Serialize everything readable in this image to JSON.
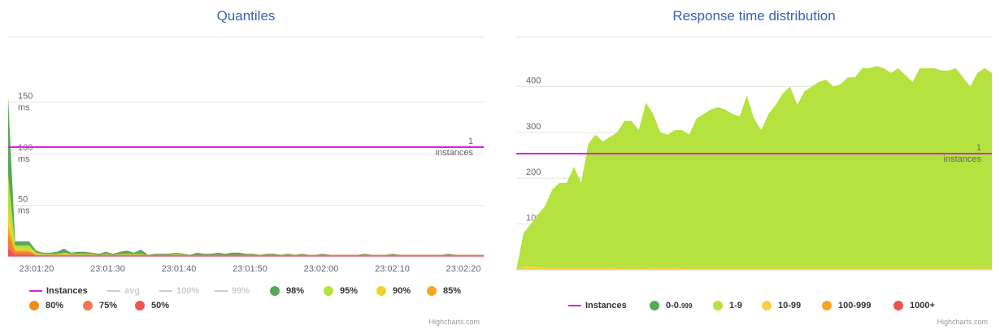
{
  "chart_data": [
    {
      "type": "area",
      "title": "Quantiles",
      "ylim": [
        0,
        160
      ],
      "y_ticks": [
        {
          "value": 150,
          "line1": "150",
          "line2": "ms"
        },
        {
          "value": 100,
          "line1": "100",
          "line2": "ms"
        },
        {
          "value": 50,
          "line1": "50",
          "line2": "ms"
        }
      ],
      "x_ticks": [
        "23:01:20",
        "23:01:30",
        "23:01:40",
        "23:01:50",
        "23:02:00",
        "23:02:10",
        "23:02:20"
      ],
      "instances": {
        "label": "1",
        "unit": "instances",
        "value": 1
      },
      "series_order_drawn": [
        "98%",
        "95%",
        "90%",
        "85%",
        "80%",
        "75%",
        "50%"
      ],
      "series": [
        {
          "name": "98%",
          "color": "#5aa75a",
          "values": [
            155,
            15,
            15,
            15,
            6,
            4,
            4,
            5,
            8,
            4,
            5,
            5,
            4,
            3,
            5,
            3,
            5,
            6,
            4,
            7,
            2,
            3,
            3,
            3,
            4,
            3,
            2,
            4,
            3,
            3,
            4,
            3,
            4,
            4,
            3,
            3,
            2,
            3,
            3,
            2,
            3,
            2,
            3,
            2,
            2,
            3,
            2,
            2,
            2,
            2,
            2,
            3,
            2,
            2,
            2,
            3,
            2,
            2,
            2,
            2,
            2,
            2,
            2,
            3,
            2,
            2,
            2,
            2,
            2
          ]
        },
        {
          "name": "95%",
          "color": "#b6e23f",
          "values": [
            80,
            11,
            11,
            11,
            4,
            3,
            3,
            3,
            4,
            3,
            3,
            3,
            3,
            2,
            3,
            2,
            3,
            3,
            3,
            3,
            2,
            2,
            2,
            2,
            3,
            2,
            2,
            2,
            2,
            2,
            2,
            2,
            2,
            2,
            2,
            2,
            2,
            2,
            2,
            2,
            2,
            2,
            2,
            2,
            2,
            2,
            2,
            2,
            2,
            2,
            2,
            2,
            2,
            2,
            2,
            2,
            2,
            2,
            2,
            2,
            2,
            2,
            2,
            2,
            2,
            2,
            2,
            2,
            2
          ]
        },
        {
          "name": "90%",
          "color": "#f2d22e",
          "values": [
            45,
            8,
            8,
            8,
            3,
            2,
            2,
            2,
            3,
            2,
            2,
            2,
            2,
            2,
            2,
            2,
            2,
            2,
            2,
            2,
            2,
            2,
            2,
            2,
            2,
            2,
            2,
            2,
            2,
            2,
            2,
            2,
            2,
            2,
            2,
            2,
            2,
            2,
            2,
            2,
            2,
            2,
            2,
            2,
            2,
            2,
            2,
            2,
            2,
            2,
            2,
            2,
            2,
            2,
            2,
            2,
            2,
            2,
            2,
            2,
            2,
            2,
            2,
            2,
            2,
            2,
            2,
            2,
            2
          ]
        },
        {
          "name": "85%",
          "color": "#f5a623",
          "values": [
            30,
            6,
            6,
            6,
            2,
            2,
            2,
            2,
            2,
            2,
            2,
            2,
            2,
            2,
            2,
            2,
            2,
            2,
            2,
            2,
            2,
            2,
            2,
            2,
            2,
            2,
            2,
            2,
            2,
            2,
            2,
            2,
            2,
            2,
            2,
            2,
            2,
            2,
            2,
            2,
            2,
            2,
            2,
            2,
            2,
            2,
            2,
            2,
            2,
            2,
            2,
            2,
            2,
            2,
            2,
            2,
            2,
            2,
            2,
            2,
            2,
            2,
            2,
            2,
            2,
            2,
            2,
            2,
            2
          ]
        },
        {
          "name": "80%",
          "color": "#f08c1e",
          "values": [
            22,
            5,
            5,
            5,
            2,
            2,
            2,
            2,
            2,
            2,
            2,
            2,
            2,
            2,
            2,
            2,
            2,
            2,
            2,
            2,
            2,
            2,
            2,
            2,
            2,
            2,
            2,
            2,
            2,
            2,
            2,
            2,
            2,
            2,
            2,
            2,
            2,
            2,
            2,
            2,
            2,
            2,
            2,
            2,
            2,
            2,
            2,
            2,
            2,
            2,
            2,
            2,
            2,
            2,
            2,
            2,
            2,
            2,
            2,
            2,
            2,
            2,
            2,
            2,
            2,
            2,
            2,
            2,
            2
          ]
        },
        {
          "name": "75%",
          "color": "#f2784b",
          "values": [
            16,
            4,
            4,
            4,
            2,
            2,
            2,
            2,
            2,
            2,
            2,
            2,
            2,
            2,
            2,
            2,
            2,
            2,
            2,
            2,
            2,
            2,
            2,
            2,
            2,
            2,
            2,
            2,
            2,
            2,
            2,
            2,
            2,
            2,
            2,
            2,
            2,
            2,
            2,
            2,
            2,
            2,
            2,
            2,
            2,
            2,
            2,
            2,
            2,
            2,
            2,
            2,
            2,
            2,
            2,
            2,
            2,
            2,
            2,
            2,
            2,
            2,
            2,
            2,
            2,
            2,
            2,
            2,
            2
          ]
        },
        {
          "name": "50%",
          "color": "#ef5350",
          "values": [
            8,
            2,
            2,
            2,
            1,
            1,
            1,
            1,
            1,
            1,
            1,
            1,
            1,
            1,
            1,
            1,
            1,
            1,
            1,
            1,
            1,
            1,
            1,
            1,
            1,
            1,
            1,
            1,
            1,
            1,
            1,
            1,
            1,
            1,
            1,
            1,
            1,
            1,
            1,
            1,
            1,
            1,
            1,
            1,
            1,
            1,
            1,
            1,
            1,
            1,
            1,
            1,
            1,
            1,
            1,
            1,
            1,
            1,
            1,
            1,
            1,
            1,
            1,
            1,
            1,
            1,
            1,
            1,
            1
          ]
        }
      ],
      "legend": [
        {
          "label": "Instances",
          "symbol": "line",
          "color": "#e619e6",
          "visible": true
        },
        {
          "label": "avg",
          "symbol": "line",
          "color": "#cccccc",
          "visible": false
        },
        {
          "label": "100%",
          "symbol": "line",
          "color": "#cccccc",
          "visible": false
        },
        {
          "label": "99%",
          "symbol": "line",
          "color": "#cccccc",
          "visible": false
        },
        {
          "label": "98%",
          "symbol": "dot",
          "color": "#5aa75a",
          "visible": true
        },
        {
          "label": "95%",
          "symbol": "dot",
          "color": "#b6e23f",
          "visible": true
        },
        {
          "label": "90%",
          "symbol": "dot",
          "color": "#f2d22e",
          "visible": true
        },
        {
          "label": "85%",
          "symbol": "dot",
          "color": "#f5a623",
          "visible": true
        },
        {
          "label": "80%",
          "symbol": "dot",
          "color": "#f08c1e",
          "visible": true
        },
        {
          "label": "75%",
          "symbol": "dot",
          "color": "#f2784b",
          "visible": true
        },
        {
          "label": "50%",
          "symbol": "dot",
          "color": "#ef5350",
          "visible": true
        }
      ],
      "credits": "Highcharts.com"
    },
    {
      "type": "area",
      "title": "Response time distribution",
      "ylim": [
        0,
        470
      ],
      "y_ticks": [
        {
          "value": 400,
          "line1": "400"
        },
        {
          "value": 300,
          "line1": "300"
        },
        {
          "value": 200,
          "line1": "200"
        },
        {
          "value": 100,
          "line1": "100"
        }
      ],
      "x_ticks": [
        "23:01:20",
        "23:01:30",
        "23:01:40",
        "23:01:50",
        "23:02:00",
        "23:02:10",
        "23:02:20"
      ],
      "instances": {
        "label": "1",
        "unit": "instances",
        "value": 1
      },
      "series": [
        {
          "name": "1-9",
          "color": "#b6e23f",
          "values": [
            0,
            80,
            100,
            120,
            140,
            175,
            190,
            190,
            225,
            190,
            275,
            295,
            280,
            290,
            300,
            325,
            325,
            305,
            365,
            340,
            300,
            295,
            305,
            305,
            295,
            330,
            340,
            350,
            355,
            350,
            340,
            335,
            380,
            330,
            305,
            340,
            360,
            385,
            400,
            360,
            390,
            400,
            410,
            415,
            400,
            405,
            420,
            420,
            440,
            440,
            445,
            440,
            430,
            440,
            425,
            410,
            440,
            440,
            440,
            435,
            435,
            440,
            420,
            400,
            430,
            440,
            430
          ]
        },
        {
          "name": "10-99",
          "color": "#f7d046",
          "values": [
            0,
            8,
            8,
            6,
            6,
            5,
            5,
            5,
            4,
            4,
            4,
            4,
            4,
            4,
            4,
            3,
            3,
            3,
            4,
            4,
            6,
            4,
            4,
            4,
            3,
            3,
            3,
            3,
            3,
            3,
            3,
            3,
            3,
            3,
            3,
            3,
            3,
            3,
            3,
            3,
            3,
            3,
            3,
            3,
            3,
            3,
            3,
            3,
            3,
            3,
            3,
            3,
            3,
            3,
            3,
            3,
            3,
            3,
            3,
            3,
            3,
            3,
            3,
            3,
            3,
            3,
            3
          ]
        }
      ],
      "legend": [
        {
          "label": "Instances",
          "symbol": "line",
          "color": "#e619e6",
          "visible": true
        },
        {
          "label": "0-0.999",
          "label_main": "0-0.",
          "label_small": "999",
          "symbol": "dot",
          "color": "#5aa75a",
          "visible": true
        },
        {
          "label": "1-9",
          "symbol": "dot",
          "color": "#b6e23f",
          "visible": true
        },
        {
          "label": "10-99",
          "symbol": "dot",
          "color": "#f7d046",
          "visible": true
        },
        {
          "label": "100-999",
          "symbol": "dot",
          "color": "#f5a623",
          "visible": true
        },
        {
          "label": "1000+",
          "symbol": "dot",
          "color": "#ef5350",
          "visible": true
        }
      ],
      "credits": "Highcharts.com"
    }
  ]
}
